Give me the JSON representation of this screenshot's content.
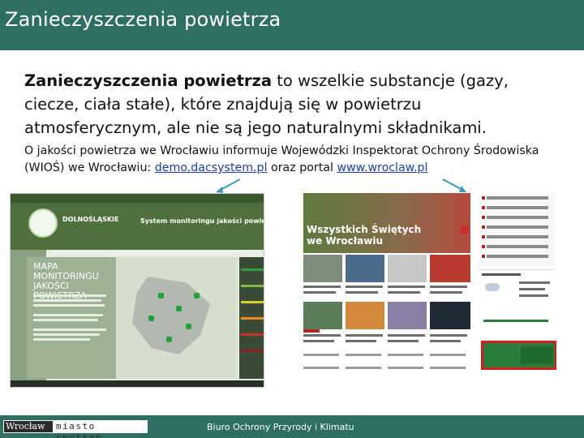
{
  "slide": {
    "title": "Zanieczyszczenia powietrza",
    "body_bold": "Zanieczyszczenia powietrza",
    "body_rest": " to wszelkie substancje (gazy, ciecze, ciała stałe), które znajdują się w powietrzu atmosferycznym, ale nie są jego naturalnymi składnikami.",
    "info_prefix": "O jakości powietrza we Wrocławiu informuje Wojewódzki Inspektorat Ochrony Środowiska (WIOŚ) we Wrocławiu: ",
    "link1": "demo.dacsystem.pl",
    "info_mid": " oraz portal ",
    "link2": "www.wroclaw.pl"
  },
  "screenshot_left": {
    "site_name": "DOLNOŚLĄSKIE",
    "system_title": "System monitoringu jakości powietrza",
    "map_title": "MAPA MONITORINGU JAKOŚCI POWIETRZA"
  },
  "screenshot_right": {
    "banner_title": "Wszystkich Świętych we Wrocławiu"
  },
  "footer": {
    "logo_word1": "Wrocław",
    "logo_word2": "miasto spotkań",
    "center_text": "Biuro Ochrony Przyrody i Klimatu"
  },
  "colors": {
    "accent": "#2e6e63",
    "link": "#1f3f9a",
    "highlight_box": "#d01f1f"
  }
}
